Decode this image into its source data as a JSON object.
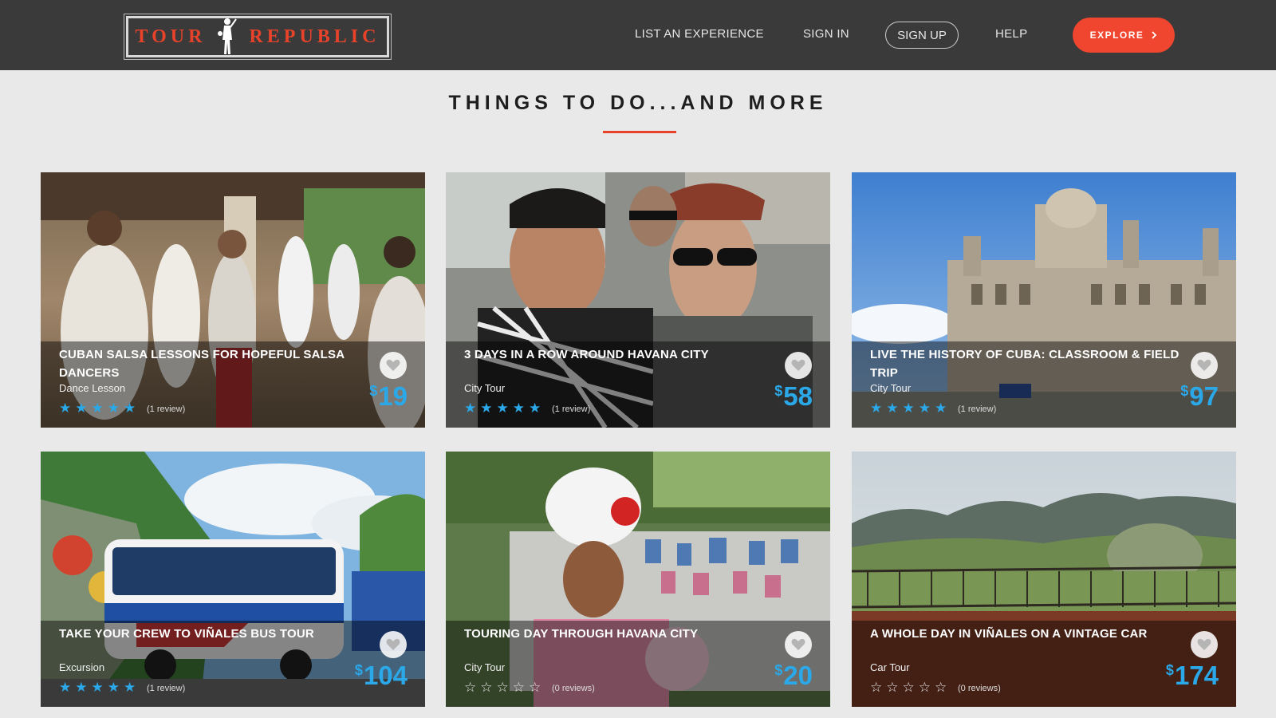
{
  "header": {
    "logo_left": "TOUR",
    "logo_right": "REPUBLIC",
    "nav": {
      "list_experience": "LIST AN EXPERIENCE",
      "sign_in": "SIGN IN",
      "sign_up": "SIGN UP",
      "help": "HELP",
      "explore": "EXPLORE"
    }
  },
  "section": {
    "title": "THINGS TO DO...AND MORE"
  },
  "currency_symbol": "$",
  "cards": [
    {
      "title": "CUBAN SALSA LESSONS FOR HOPEFUL SALSA DANCERS",
      "category": "Dance Lesson",
      "rating": 5,
      "reviews": "(1 review)",
      "price": "19"
    },
    {
      "title": "3 DAYS IN A ROW AROUND HAVANA CITY",
      "category": "City Tour",
      "rating": 5,
      "reviews": "(1 review)",
      "price": "58"
    },
    {
      "title": "LIVE THE HISTORY OF CUBA: CLASSROOM & FIELD TRIP",
      "category": "City Tour",
      "rating": 5,
      "reviews": "(1 review)",
      "price": "97"
    },
    {
      "title": "TAKE YOUR CREW TO VIÑALES BUS TOUR",
      "category": "Excursion",
      "rating": 5,
      "reviews": "(1 review)",
      "price": "104"
    },
    {
      "title": "TOURING DAY THROUGH HAVANA CITY",
      "category": "City Tour",
      "rating": 0,
      "reviews": "(0 reviews)",
      "price": "20"
    },
    {
      "title": "A WHOLE DAY IN VIÑALES ON A VINTAGE CAR",
      "category": "Car Tour",
      "rating": 0,
      "reviews": "(0 reviews)",
      "price": "174"
    }
  ],
  "colors": {
    "header_bg": "#3a3a3a",
    "accent": "#f0462f",
    "price_blue": "#2aa8e8",
    "page_bg": "#e9e9e9"
  }
}
